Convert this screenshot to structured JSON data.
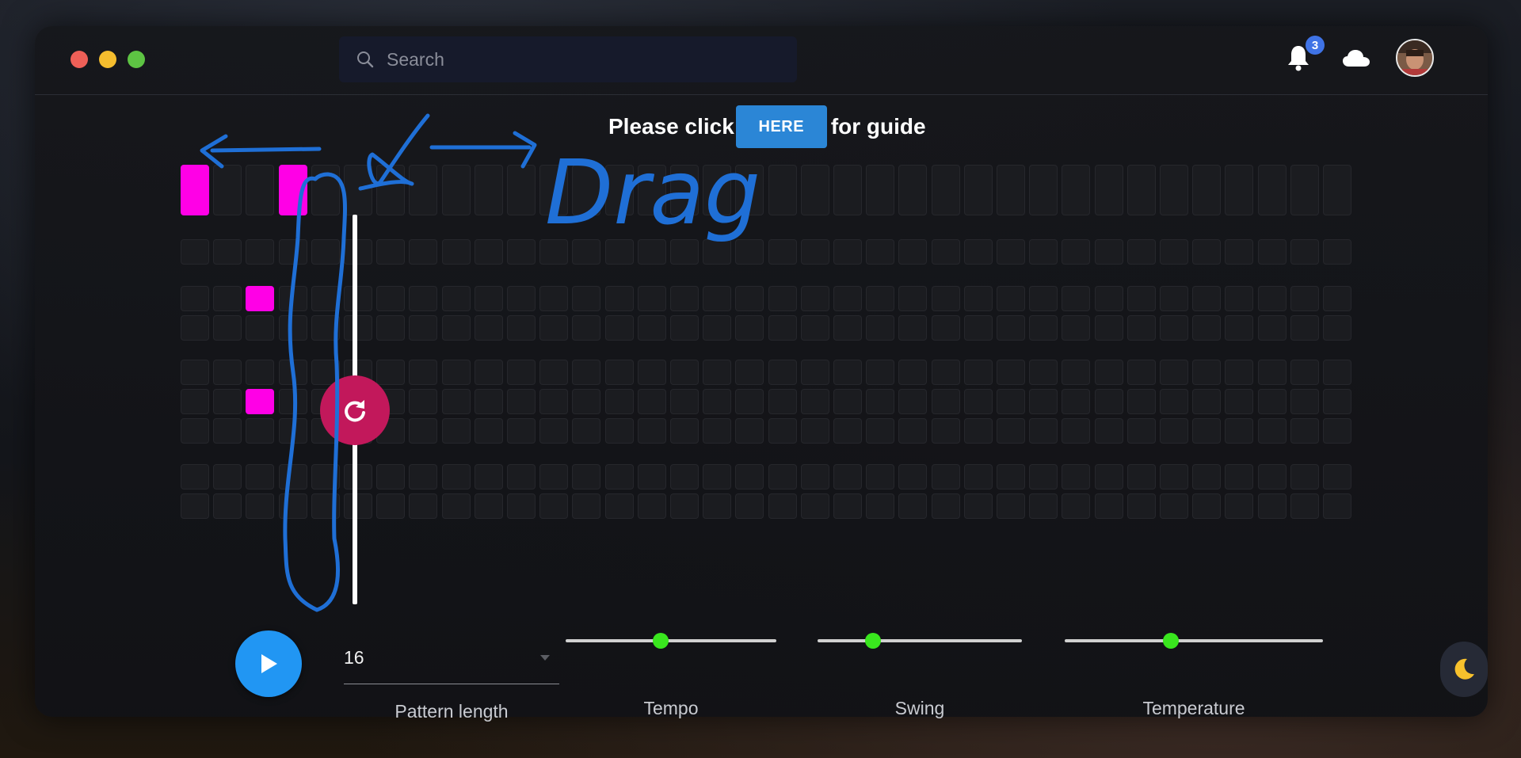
{
  "window_controls": [
    {
      "name": "close",
      "color": "#ee5f57"
    },
    {
      "name": "minimize",
      "color": "#f5bd2e"
    },
    {
      "name": "maximize",
      "color": "#5dc443"
    }
  ],
  "search": {
    "placeholder": "Search",
    "icon": "search-icon"
  },
  "header": {
    "notifications": {
      "icon": "bell-icon",
      "count": "3"
    },
    "cloud": {
      "icon": "cloud-icon"
    },
    "avatar": {
      "icon": "user-avatar"
    }
  },
  "guide": {
    "prefix": "Please click",
    "button_label": "HERE",
    "suffix": "for guide"
  },
  "sequencer": {
    "steps": 36,
    "rows": 10,
    "active_cells": [
      [
        0,
        0
      ],
      [
        0,
        3
      ],
      [
        2,
        2
      ],
      [
        5,
        2
      ]
    ],
    "current_step": 4,
    "reset_icon": "refresh-icon",
    "cell_on_color": "#ff00e6"
  },
  "controls": {
    "play_icon": "play-icon",
    "pattern_length": {
      "value": "16",
      "label": "Pattern length"
    },
    "tempo": {
      "label": "Tempo",
      "level": 0.45
    },
    "swing": {
      "label": "Swing",
      "level": 0.27
    },
    "temperature": {
      "label": "Temperature",
      "level": 0.41
    }
  },
  "theme_toggle": {
    "icon": "moon-icon"
  },
  "annotation": {
    "text": "Drag",
    "color": "#1f6fd6"
  }
}
